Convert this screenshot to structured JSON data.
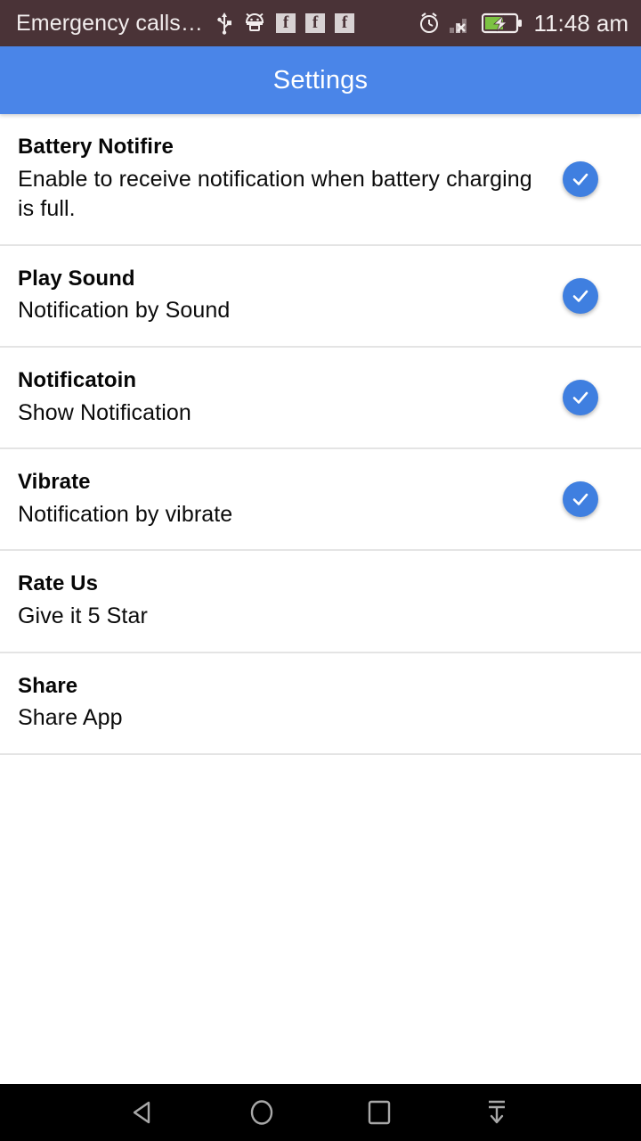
{
  "status_bar": {
    "carrier_text": "Emergency calls…",
    "time": "11:48 am",
    "background_color": "#4a3337",
    "text_color": "#f2eded",
    "icons": [
      {
        "name": "usb-icon",
        "label": "USB"
      },
      {
        "name": "android-debug-icon",
        "label": "Android"
      },
      {
        "name": "facebook-icon-1",
        "label": "f"
      },
      {
        "name": "facebook-icon-2",
        "label": "f"
      },
      {
        "name": "facebook-icon-3",
        "label": "f"
      }
    ],
    "right_icons": [
      {
        "name": "alarm-clock-icon",
        "label": "Alarm set"
      },
      {
        "name": "no-signal-icon",
        "label": "No signal"
      },
      {
        "name": "battery-charging-icon",
        "label": "Battery charging"
      }
    ],
    "battery_fill_color": "#7cc242"
  },
  "app_bar": {
    "title": "Settings",
    "background_color": "#4a85e8",
    "title_color": "#ffffff"
  },
  "accent_color": "#3f7fe0",
  "settings_list": [
    {
      "name": "battery-notifire",
      "title": "Battery Notifire",
      "subtitle": "Enable to receive notification when battery charging is full.",
      "checked": true
    },
    {
      "name": "play-sound",
      "title": "Play Sound",
      "subtitle": "Notification by Sound",
      "checked": true
    },
    {
      "name": "notification",
      "title": "Notificatoin",
      "subtitle": "Show Notification",
      "checked": true
    },
    {
      "name": "vibrate",
      "title": "Vibrate",
      "subtitle": "Notification by vibrate",
      "checked": true
    },
    {
      "name": "rate-us",
      "title": "Rate Us",
      "subtitle": "Give it 5 Star",
      "checked": false
    },
    {
      "name": "share",
      "title": "Share",
      "subtitle": "Share App",
      "checked": false
    }
  ],
  "nav_bar": {
    "background_color": "#000000",
    "buttons": [
      {
        "name": "back-button",
        "label": "Back"
      },
      {
        "name": "home-button",
        "label": "Home"
      },
      {
        "name": "recents-button",
        "label": "Recents"
      },
      {
        "name": "hide-navbar-button",
        "label": "Hide navigation bar"
      }
    ]
  }
}
